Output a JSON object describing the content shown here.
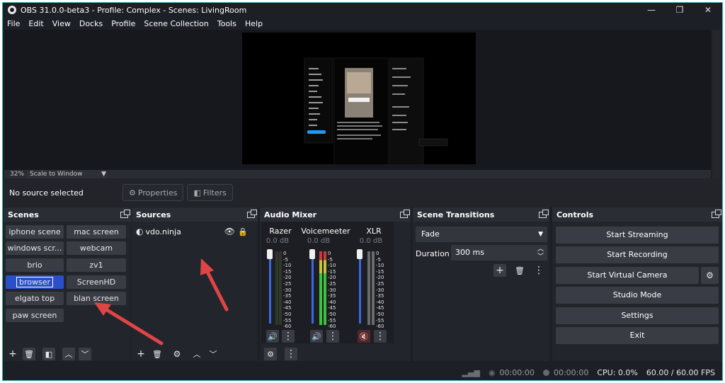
{
  "window": {
    "title": "OBS 31.0.0-beta3 - Profile: Complex - Scenes: LivingRoom",
    "minimize_glyph": "—",
    "maximize_glyph": "❐",
    "close_glyph": "✕"
  },
  "menu": [
    "File",
    "Edit",
    "View",
    "Docks",
    "Profile",
    "Scene Collection",
    "Tools",
    "Help"
  ],
  "preview": {
    "zoom": "32%",
    "scale_mode": "Scale to Window"
  },
  "source_toolbar": {
    "status": "No source selected",
    "properties_label": "Properties",
    "filters_label": "Filters"
  },
  "scenes": {
    "title": "Scenes",
    "items": [
      "iphone scene",
      "mac screen",
      "windows scr...",
      "webcam",
      "brio",
      "zv1",
      "browser",
      "ScreenHD",
      "elgato top",
      "blan screen",
      "paw screen"
    ],
    "active": "browser"
  },
  "sources": {
    "title": "Sources",
    "items": [
      {
        "name": "vdo.ninja",
        "visible": true,
        "locked": true
      }
    ]
  },
  "audio_mixer": {
    "title": "Audio Mixer",
    "scale": [
      "0",
      "-5",
      "-10",
      "-15",
      "-20",
      "-25",
      "-30",
      "-35",
      "-40",
      "-45",
      "-50",
      "-55",
      "-60"
    ],
    "channels": [
      {
        "name": "Razer",
        "db": "0.0 dB",
        "muted": false
      },
      {
        "name": "Voicemeeter",
        "db": "0.0 dB",
        "muted": false
      },
      {
        "name": "XLR",
        "db": "0.0 dB",
        "muted": true
      }
    ]
  },
  "transitions": {
    "title": "Scene Transitions",
    "selected": "Fade",
    "duration_label": "Duration",
    "duration_value": "300 ms"
  },
  "controls": {
    "title": "Controls",
    "start_streaming": "Start Streaming",
    "start_recording": "Start Recording",
    "start_virtual_camera": "Start Virtual Camera",
    "studio_mode": "Studio Mode",
    "settings": "Settings",
    "exit": "Exit"
  },
  "status": {
    "stream_time": "00:00:00",
    "record_time": "00:00:00",
    "cpu": "CPU: 0.0%",
    "fps": "60.00 / 60.00 FPS"
  },
  "colors": {
    "accent": "#2a50c8",
    "annotation_arrow": "#e04545",
    "window_border": "#30b3b3",
    "meter_green": "#3cc23c",
    "meter_yellow": "#c8c23a",
    "meter_red": "#c83a3a"
  }
}
